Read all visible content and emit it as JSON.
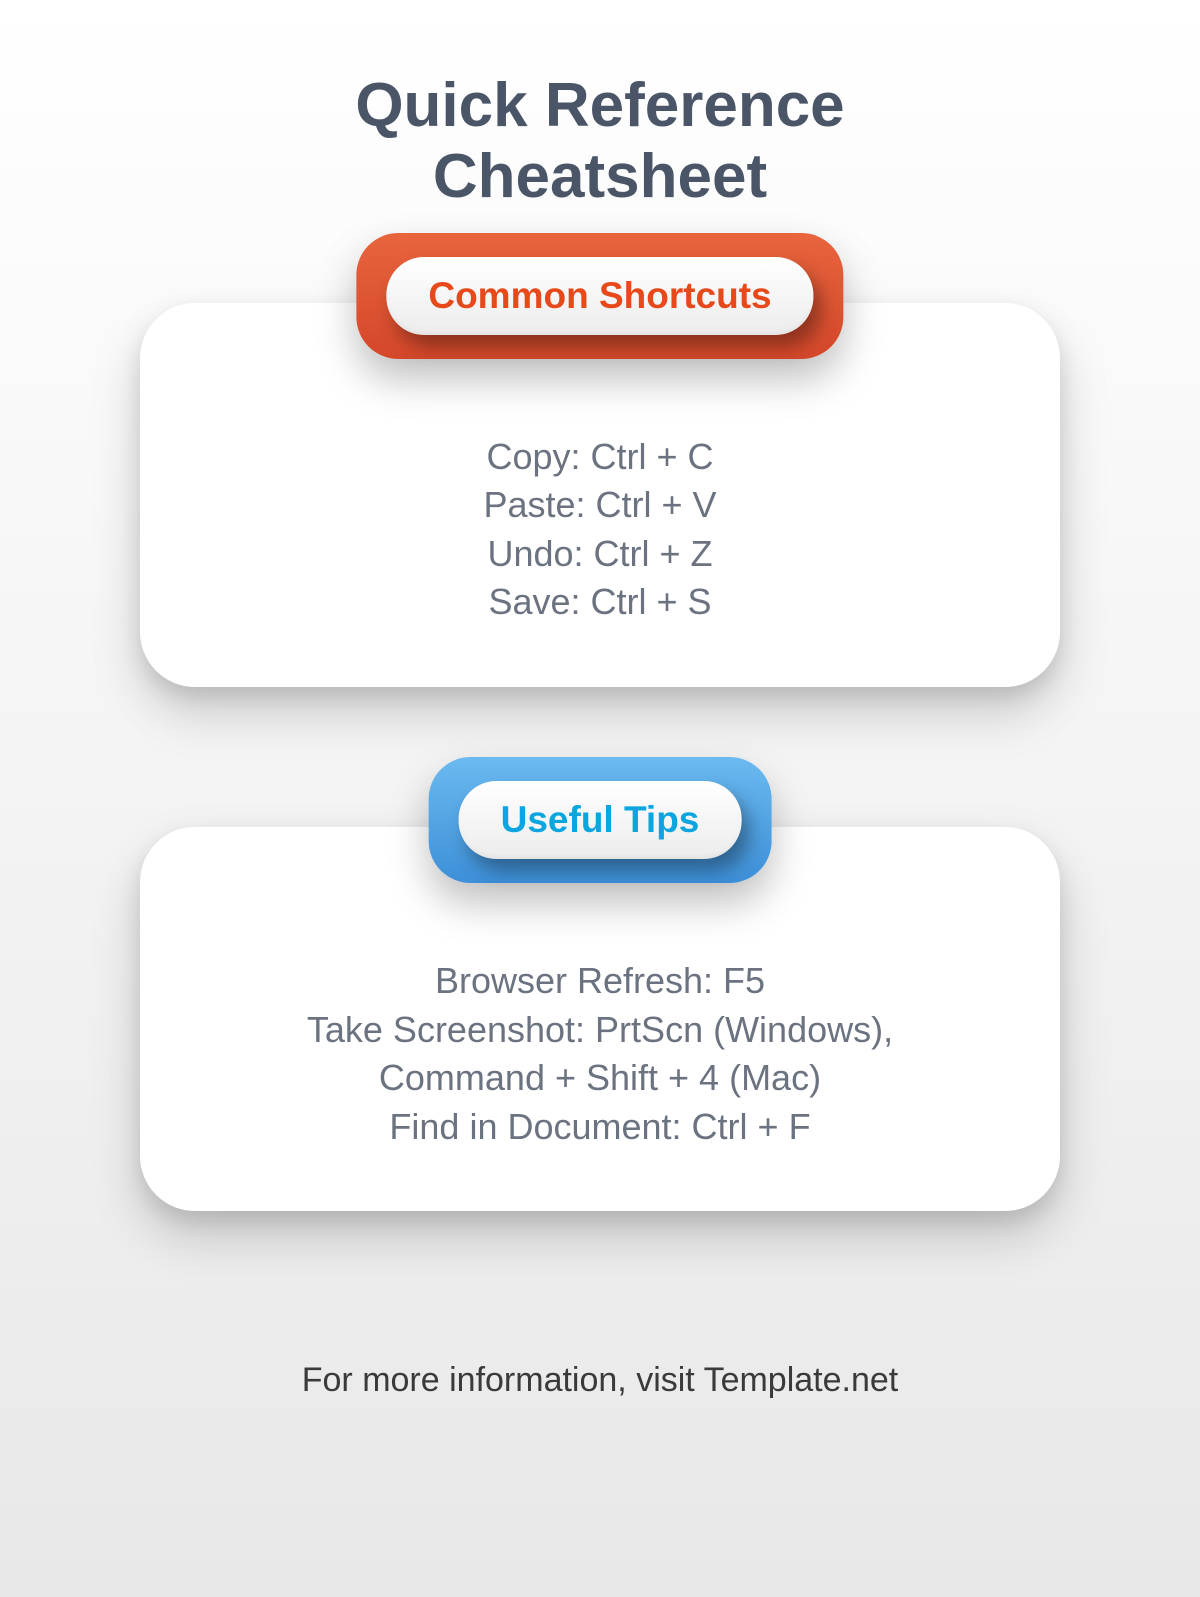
{
  "title_line1": "Quick Reference",
  "title_line2": "Cheatsheet",
  "sections": [
    {
      "heading": "Common Shortcuts",
      "lines": [
        "Copy: Ctrl + C",
        "Paste: Ctrl + V",
        "Undo: Ctrl + Z",
        "Save: Ctrl + S"
      ]
    },
    {
      "heading": "Useful Tips",
      "lines": [
        "Browser Refresh: F5",
        "Take Screenshot: PrtScn (Windows),",
        "Command + Shift + 4 (Mac)",
        "Find in Document: Ctrl + F"
      ]
    }
  ],
  "footer": "For more information, visit Template.net"
}
